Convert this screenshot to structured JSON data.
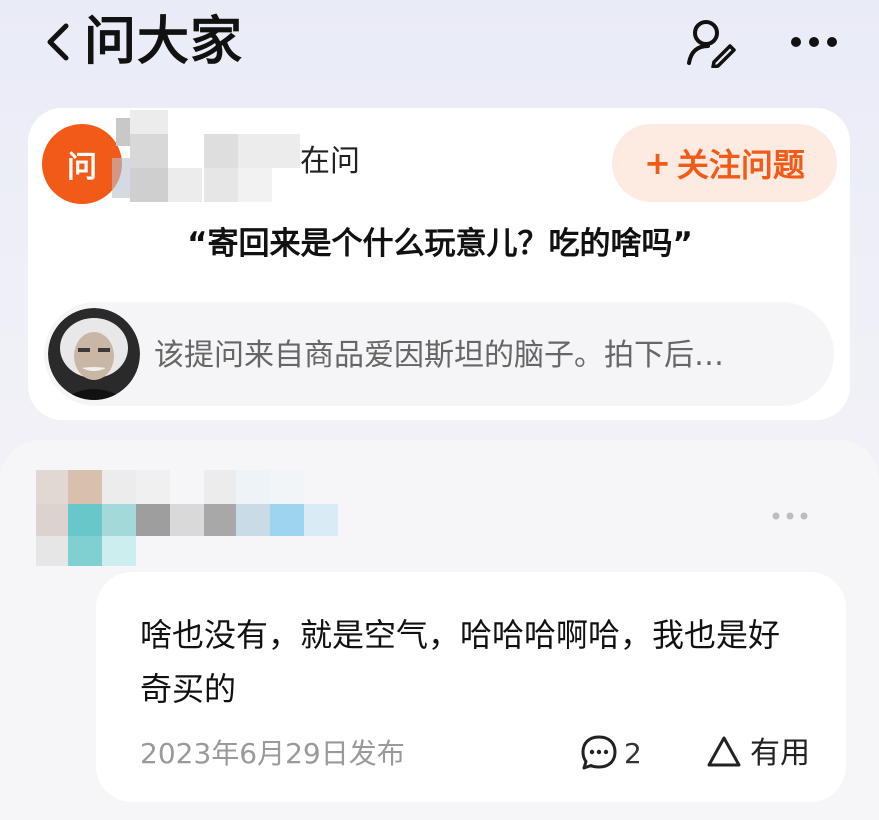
{
  "header": {
    "title": "问大家",
    "back_icon": "chevron-left-icon",
    "user_edit_icon": "user-edit-icon",
    "more_icon": "more-horizontal-icon"
  },
  "question": {
    "badge": "问",
    "asking_label": "在问",
    "follow_label": "关注问题",
    "follow_plus": "+",
    "text": "“寄回来是个什么玩意儿？吃的啥吗”",
    "source_text": "该提问来自商品爱因斯坦的脑子。拍下后…",
    "accent_color": "#f25a18"
  },
  "answer": {
    "text": "啥也没有，就是空气，哈哈哈啊哈，我也是好奇买的",
    "date": "2023年6月29日发布",
    "comment_count": "2",
    "useful_label": "有用"
  }
}
